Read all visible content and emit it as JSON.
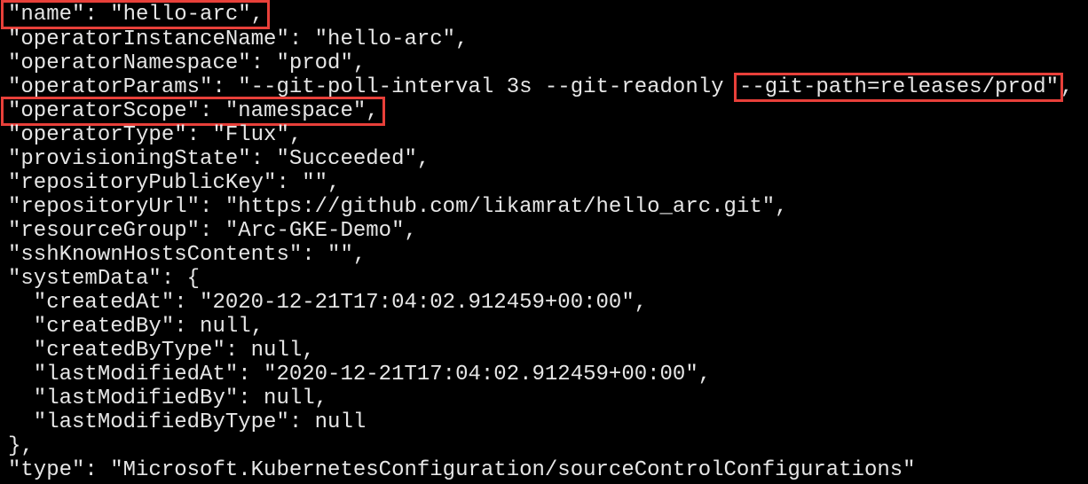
{
  "terminal": {
    "lines": [
      {
        "pre": "",
        "highlight": "\"name\": \"hello-arc\",",
        "post": ""
      },
      {
        "pre": "\"operatorInstanceName\": \"hello-arc\",",
        "highlight": "",
        "post": ""
      },
      {
        "pre": "\"operatorNamespace\": \"prod\",",
        "highlight": "",
        "post": ""
      },
      {
        "pre": "\"operatorParams\": \"--git-poll-interval 3s --git-readonly ",
        "highlight": "--git-path=releases/prod\"",
        "post": ","
      },
      {
        "pre": "",
        "highlight": "\"operatorScope\": \"namespace\",",
        "post": ""
      },
      {
        "pre": "\"operatorType\": \"Flux\",",
        "highlight": "",
        "post": ""
      },
      {
        "pre": "\"provisioningState\": \"Succeeded\",",
        "highlight": "",
        "post": ""
      },
      {
        "pre": "\"repositoryPublicKey\": \"\",",
        "highlight": "",
        "post": ""
      },
      {
        "pre": "\"repositoryUrl\": \"https://github.com/likamrat/hello_arc.git\",",
        "highlight": "",
        "post": ""
      },
      {
        "pre": "\"resourceGroup\": \"Arc-GKE-Demo\",",
        "highlight": "",
        "post": ""
      },
      {
        "pre": "\"sshKnownHostsContents\": \"\",",
        "highlight": "",
        "post": ""
      },
      {
        "pre": "\"systemData\": {",
        "highlight": "",
        "post": ""
      },
      {
        "pre": "  \"createdAt\": \"2020-12-21T17:04:02.912459+00:00\",",
        "highlight": "",
        "post": ""
      },
      {
        "pre": "  \"createdBy\": null,",
        "highlight": "",
        "post": ""
      },
      {
        "pre": "  \"createdByType\": null,",
        "highlight": "",
        "post": ""
      },
      {
        "pre": "  \"lastModifiedAt\": \"2020-12-21T17:04:02.912459+00:00\",",
        "highlight": "",
        "post": ""
      },
      {
        "pre": "  \"lastModifiedBy\": null,",
        "highlight": "",
        "post": ""
      },
      {
        "pre": "  \"lastModifiedByType\": null",
        "highlight": "",
        "post": ""
      },
      {
        "pre": "},",
        "highlight": "",
        "post": ""
      },
      {
        "pre": "\"type\": \"Microsoft.KubernetesConfiguration/sourceControlConfigurations\"",
        "highlight": "",
        "post": ""
      }
    ]
  },
  "colors": {
    "background": "#000000",
    "text": "#e6e6e6",
    "highlight_border": "#e8403a"
  }
}
